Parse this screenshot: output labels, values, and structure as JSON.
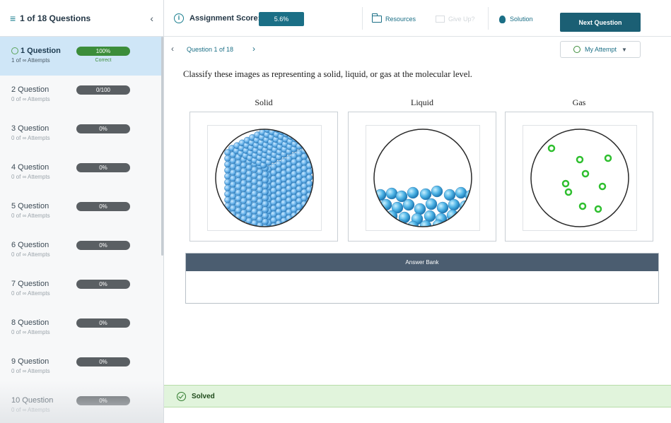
{
  "sidebar": {
    "title": "1 of 18 Questions",
    "items": [
      {
        "name": "1 Question",
        "attempts": "1 of ∞ Attempts",
        "score": "100%",
        "status": "Correct",
        "active": true
      },
      {
        "name": "2 Question",
        "attempts": "0 of ∞ Attempts",
        "score": "0/100",
        "status": ""
      },
      {
        "name": "3 Question",
        "attempts": "0 of ∞ Attempts",
        "score": "0%",
        "status": ""
      },
      {
        "name": "4 Question",
        "attempts": "0 of ∞ Attempts",
        "score": "0%",
        "status": ""
      },
      {
        "name": "5 Question",
        "attempts": "0 of ∞ Attempts",
        "score": "0%",
        "status": ""
      },
      {
        "name": "6 Question",
        "attempts": "0 of ∞ Attempts",
        "score": "0%",
        "status": ""
      },
      {
        "name": "7 Question",
        "attempts": "0 of ∞ Attempts",
        "score": "0%",
        "status": ""
      },
      {
        "name": "8 Question",
        "attempts": "0 of ∞ Attempts",
        "score": "0%",
        "status": ""
      },
      {
        "name": "9 Question",
        "attempts": "0 of ∞ Attempts",
        "score": "0%",
        "status": ""
      },
      {
        "name": "10 Question",
        "attempts": "0 of ∞ Attempts",
        "score": "0%",
        "status": ""
      }
    ]
  },
  "topbar": {
    "score_label": "Assignment Score:",
    "score_value": "5.6%",
    "resources_label": "Resources",
    "give_up_label": "Give Up?",
    "solution_label": "Solution",
    "next_label": "Next Question"
  },
  "qnav": {
    "label": "Question 1 of 18",
    "attempt_label": "My Attempt"
  },
  "question": {
    "prompt": "Classify these images as representing a solid, liquid, or gas at the molecular level.",
    "columns": [
      {
        "label": "Solid"
      },
      {
        "label": "Liquid"
      },
      {
        "label": "Gas"
      }
    ],
    "answer_bank_label": "Answer Bank"
  },
  "solved": {
    "label": "Solved"
  },
  "colors": {
    "teal": "#1b6f86",
    "green": "#3c8d3a",
    "active": "#cfe6f7",
    "bank": "#4b5d70"
  }
}
